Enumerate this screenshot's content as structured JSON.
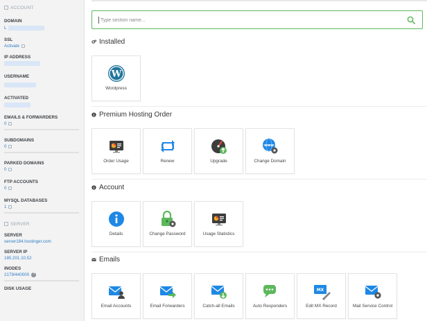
{
  "sidebar": {
    "account_header": "ACCOUNT",
    "domain_label": "DOMAIN",
    "domain_value": "L",
    "ssl_label": "SSL",
    "ssl_value": "Activate",
    "ip_label": "IP ADDRESS",
    "username_label": "USERNAME",
    "activated_label": "ACTIVATED",
    "emails_label": "EMAILS & FORWARDERS",
    "emails_value": "0",
    "subdomains_label": "SUBDOMAINS",
    "subdomains_value": "0",
    "parked_label": "PARKED DOMAINS",
    "parked_value": "0",
    "ftp_label": "FTP ACCOUNTS",
    "ftp_value": "0",
    "mysql_label": "MYSQL DATABASES",
    "mysql_value": "1",
    "server_header": "SERVER",
    "server_label": "SERVER",
    "server_value": "server184.hostinger.com",
    "server_ip_label": "SERVER IP",
    "server_ip_value": "185.201.10.52",
    "inodes_label": "INODES",
    "inodes_value": "2179/440000",
    "disk_label": "DISK USAGE"
  },
  "search": {
    "placeholder": "Type section name..."
  },
  "installed": {
    "title": "Installed",
    "tiles": [
      {
        "label": "Wordpress",
        "icon": "wordpress-icon"
      }
    ]
  },
  "premium": {
    "title": "Premium Hosting Order",
    "tiles": [
      {
        "label": "Order Usage",
        "icon": "order-usage-icon"
      },
      {
        "label": "Renew",
        "icon": "renew-icon"
      },
      {
        "label": "Upgrade",
        "icon": "upgrade-icon"
      },
      {
        "label": "Change Domain",
        "icon": "change-domain-icon"
      }
    ]
  },
  "account": {
    "title": "Account",
    "tiles": [
      {
        "label": "Details",
        "icon": "details-icon"
      },
      {
        "label": "Change Password",
        "icon": "change-password-icon"
      },
      {
        "label": "Usage Statistics",
        "icon": "usage-statistics-icon"
      }
    ]
  },
  "emails": {
    "title": "Emails",
    "tiles": [
      {
        "label": "Email Accounts",
        "icon": "email-accounts-icon"
      },
      {
        "label": "Email Forwarders",
        "icon": "email-forwarders-icon"
      },
      {
        "label": "Catch-all Emails",
        "icon": "catch-all-icon"
      },
      {
        "label": "Auto Responders",
        "icon": "auto-responders-icon"
      },
      {
        "label": "Edit MX Record",
        "icon": "mx-record-icon"
      },
      {
        "label": "Mail Service Control",
        "icon": "mail-service-icon"
      }
    ]
  },
  "colors": {
    "accent": "#2f7ec7",
    "search_border": "#5cb85c",
    "icon_blue": "#1e88e5",
    "icon_green": "#5cb85c"
  }
}
